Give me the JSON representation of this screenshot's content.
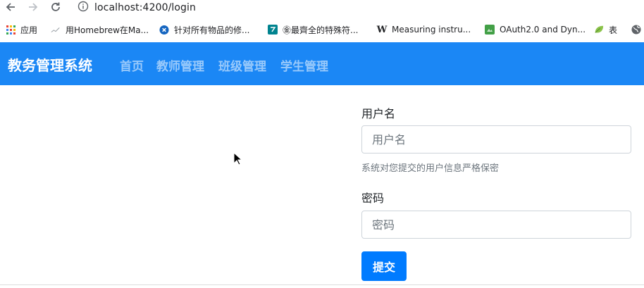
{
  "browser": {
    "url": "localhost:4200/login",
    "bookmarks": [
      {
        "label": "应用",
        "icon": "apps-grid-icon"
      },
      {
        "label": "用Homebrew在Ma...",
        "icon": "homebrew-icon"
      },
      {
        "label": "针对所有物品的修...",
        "icon": "close-circle-icon"
      },
      {
        "label": "㊎最齊全的特殊符...",
        "icon": "bookmark-s-icon"
      },
      {
        "label": "Measuring instru...",
        "icon": "wikipedia-icon"
      },
      {
        "label": "OAuth2.0 and Dyn...",
        "icon": "doc-green-icon"
      },
      {
        "label": "表",
        "icon": "leaf-icon"
      }
    ]
  },
  "navbar": {
    "brand": "教务管理系统",
    "links": [
      "首页",
      "教师管理",
      "班级管理",
      "学生管理"
    ],
    "color": "#1b87f5"
  },
  "form": {
    "username_label": "用户名",
    "username_placeholder": "用户名",
    "username_help": "系统对您提交的用户信息严格保密",
    "password_label": "密码",
    "password_placeholder": "密码",
    "submit_label": "提交",
    "submit_color": "#007bff"
  }
}
